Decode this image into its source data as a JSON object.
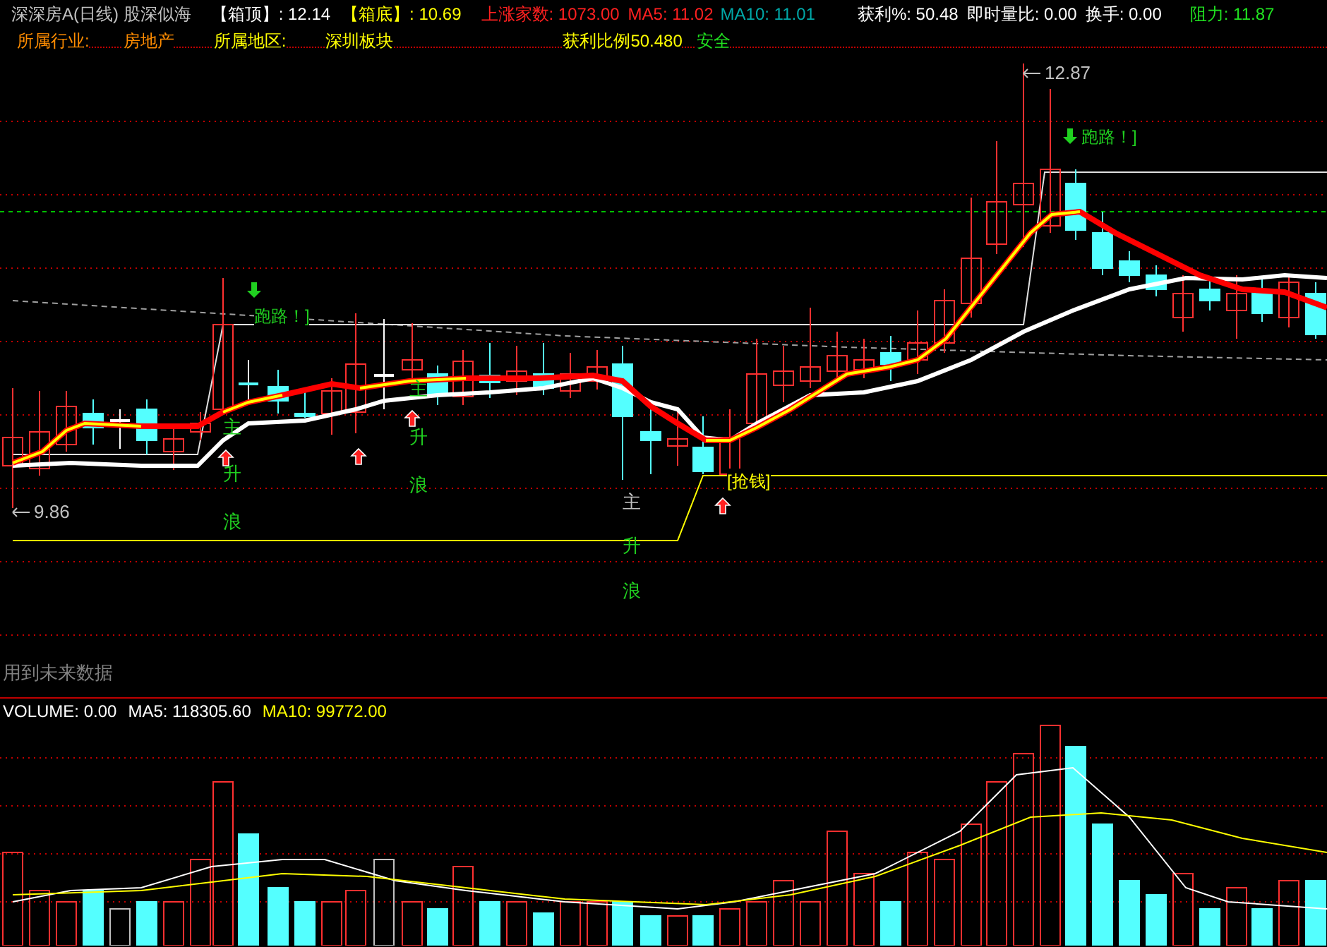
{
  "header": {
    "row_1": [
      {
        "text": "深深房A(日线) 股深似海",
        "color": "#c0c0c0"
      },
      {
        "text": "【箱顶】: 12.14",
        "color": "#ffffff"
      },
      {
        "text": "【箱底】: 10.69",
        "color": "#ffff00"
      },
      {
        "text": "上涨家数: 1073.00",
        "color": "#ff2020"
      },
      {
        "text": "MA5: 11.02",
        "color": "#ff2020"
      },
      {
        "text": "MA10: 11.01",
        "color": "#00a8a8"
      },
      {
        "text": "获利%: 50.48",
        "color": "#ffffff"
      },
      {
        "text": "即时量比: 0.00",
        "color": "#ffffff"
      },
      {
        "text": "换手: 0.00",
        "color": "#ffffff"
      },
      {
        "text": "阻力: 11.87",
        "color": "#20e020"
      }
    ],
    "row_2": [
      {
        "text": "所属行业:",
        "color": "#ff8c00"
      },
      {
        "text": "房地产",
        "color": "#ff8c00"
      },
      {
        "text": "所属地区:",
        "color": "#ffff00"
      },
      {
        "text": "深圳板块",
        "color": "#ffff00"
      },
      {
        "text": "获利比例50.480",
        "color": "#ffff00"
      },
      {
        "text": "安全",
        "color": "#20e020"
      }
    ]
  },
  "price_chart": {
    "high_label": "12.87",
    "low_label": "9.86",
    "signals": [
      {
        "kind": "sell",
        "text": "跑路！]"
      },
      {
        "kind": "sell",
        "text": "跑路！]"
      },
      {
        "kind": "buy",
        "text": "[抢钱]"
      }
    ],
    "wave_labels": [
      [
        "主",
        "升",
        "浪"
      ],
      [
        "主",
        "升",
        "浪"
      ],
      [
        "主",
        "升",
        "浪"
      ]
    ],
    "note": "用到未来数据"
  },
  "volume_chart": {
    "legend": [
      {
        "text": "VOLUME: 0.00",
        "color": "#ffffff"
      },
      {
        "text": "MA5: 118305.60",
        "color": "#ffffff"
      },
      {
        "text": "MA10: 99772.00",
        "color": "#ffff00"
      }
    ]
  }
}
